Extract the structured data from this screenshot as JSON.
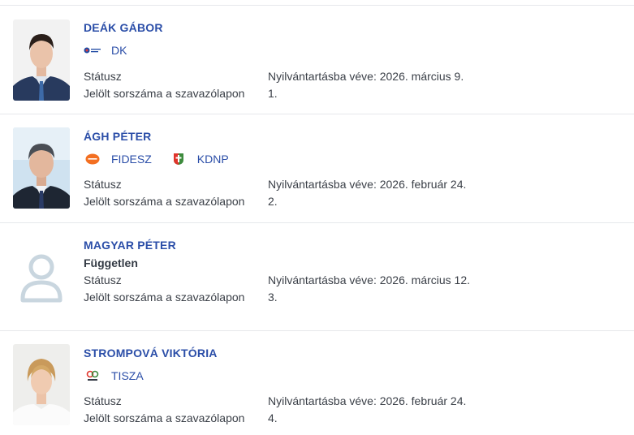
{
  "labels": {
    "status": "Státusz",
    "ballot_number": "Jelölt sorszáma a szavazólapon"
  },
  "candidates": [
    {
      "name": "DEÁK GÁBOR",
      "parties": [
        {
          "label": "DK",
          "icon": "dk-logo-icon"
        }
      ],
      "status_value": "Nyilvántartásba véve: 2026. március 9.",
      "ballot_value": "1."
    },
    {
      "name": "ÁGH PÉTER",
      "parties": [
        {
          "label": "FIDESZ",
          "icon": "fidesz-logo-icon"
        },
        {
          "label": "KDNP",
          "icon": "kdnp-logo-icon"
        }
      ],
      "status_value": "Nyilvántartásba véve: 2026. február 24.",
      "ballot_value": "2."
    },
    {
      "name": "MAGYAR PÉTER",
      "independent": "Független",
      "status_value": "Nyilvántartásba véve: 2026. március 12.",
      "ballot_value": "3."
    },
    {
      "name": "STROMPOVÁ VIKTÓRIA",
      "parties": [
        {
          "label": "TISZA",
          "icon": "tisza-logo-icon"
        }
      ],
      "status_value": "Nyilvántartásba véve: 2026. február 24.",
      "ballot_value": "4."
    }
  ],
  "colors": {
    "link": "#2b4ea8",
    "divider": "#e6e8eb",
    "fidesz_orange": "#f36f21",
    "placeholder_avatar": "#c9d6df"
  }
}
